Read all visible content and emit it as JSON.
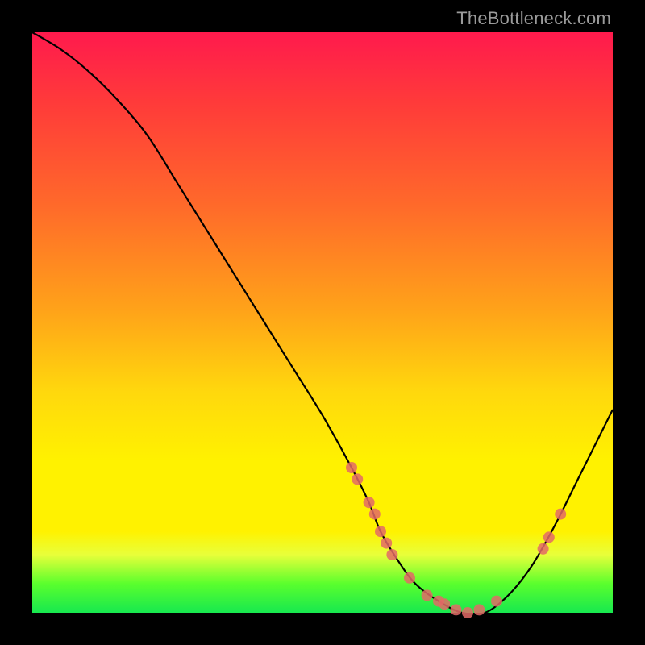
{
  "attribution": "TheBottleneck.com",
  "chart_data": {
    "type": "line",
    "title": "",
    "xlabel": "",
    "ylabel": "",
    "xlim": [
      0,
      100
    ],
    "ylim": [
      0,
      100
    ],
    "grid": false,
    "legend": false,
    "background_gradient": {
      "top": "#ff1a4d",
      "upper_mid": "#ffa319",
      "lower_mid": "#fff200",
      "bottom": "#17e84f"
    },
    "series": [
      {
        "name": "bottleneck-curve",
        "color": "#000000",
        "x": [
          0,
          5,
          10,
          15,
          20,
          25,
          30,
          35,
          40,
          45,
          50,
          55,
          58,
          60,
          63,
          66,
          70,
          74,
          78,
          82,
          86,
          90,
          94,
          98,
          100
        ],
        "y": [
          100,
          97,
          93,
          88,
          82,
          74,
          66,
          58,
          50,
          42,
          34,
          25,
          19,
          14,
          9,
          5,
          2,
          0,
          0,
          3,
          8,
          15,
          23,
          31,
          35
        ]
      }
    ],
    "markers": {
      "color": "#e36a66",
      "comment": "salmon highlight dots overlaid on the curve near the minimum and on the rising branch",
      "points": [
        {
          "x": 55,
          "y": 25
        },
        {
          "x": 56,
          "y": 23
        },
        {
          "x": 58,
          "y": 19
        },
        {
          "x": 59,
          "y": 17
        },
        {
          "x": 60,
          "y": 14
        },
        {
          "x": 61,
          "y": 12
        },
        {
          "x": 62,
          "y": 10
        },
        {
          "x": 65,
          "y": 6
        },
        {
          "x": 68,
          "y": 3
        },
        {
          "x": 70,
          "y": 2
        },
        {
          "x": 71,
          "y": 1.5
        },
        {
          "x": 73,
          "y": 0.5
        },
        {
          "x": 75,
          "y": 0
        },
        {
          "x": 77,
          "y": 0.5
        },
        {
          "x": 80,
          "y": 2
        },
        {
          "x": 88,
          "y": 11
        },
        {
          "x": 89,
          "y": 13
        },
        {
          "x": 91,
          "y": 17
        }
      ]
    }
  }
}
